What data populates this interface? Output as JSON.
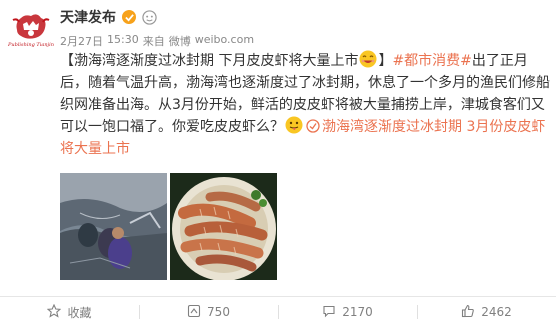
{
  "account": {
    "name": "天津发布",
    "logo_text": "Publishing Tianjin"
  },
  "meta": {
    "date": "2月27日",
    "time": "15:30",
    "source_prefix": "来自",
    "source": "微博",
    "site": "weibo.com"
  },
  "post": {
    "title_link": "【渤海湾逐渐度过冰封期 下月皮皮虾将大量上市",
    "title_close": "】",
    "hashtag": "#都市消费#",
    "body": "出了正月后，随着气温升高，渤海湾也逐渐度过了冰封期，休息了一个多月的渔民们修船织网准备出海。从3月份开始，鲜活的皮皮虾将被大量捕捞上岸，津城食客们又可以一饱口福了。你爱吃皮皮虾么？",
    "article_link": "渤海湾逐渐度过冰封期 3月份皮皮虾将大量上市"
  },
  "actions": {
    "favorite": "收藏",
    "reposts": "750",
    "comments": "2170",
    "likes": "2462"
  },
  "colors": {
    "link": "#eb7350",
    "brand_red": "#c0141b",
    "muted": "#808080"
  },
  "icons": [
    "verified-icon",
    "member-icon",
    "smile-emoji-icon",
    "tongue-emoji-icon",
    "web-link-icon",
    "star-icon",
    "repost-icon",
    "comment-icon",
    "like-icon"
  ]
}
